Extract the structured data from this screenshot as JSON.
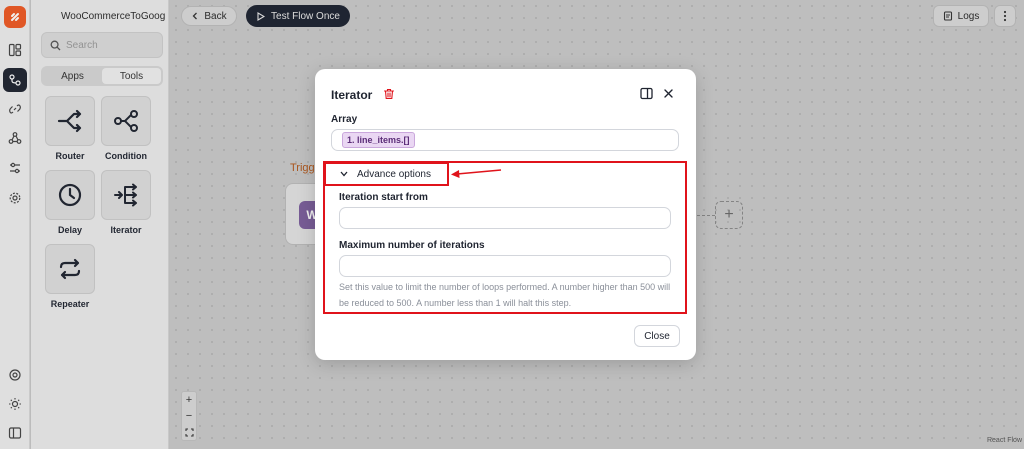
{
  "sidebar": {
    "flow_name": "WooCommerceToGoogle",
    "search_placeholder": "Search",
    "tabs": [
      {
        "label": "Apps",
        "active": false
      },
      {
        "label": "Tools",
        "active": true
      }
    ],
    "tools": [
      {
        "label": "Router",
        "icon": "router-icon"
      },
      {
        "label": "Condition",
        "icon": "condition-icon"
      },
      {
        "label": "Delay",
        "icon": "clock-icon"
      },
      {
        "label": "Iterator",
        "icon": "iterator-icon"
      },
      {
        "label": "Repeater",
        "icon": "repeat-icon"
      }
    ]
  },
  "toolbar": {
    "back_label": "Back",
    "test_label": "Test Flow Once",
    "logs_label": "Logs"
  },
  "canvas": {
    "trigger_label": "Trigg",
    "woo_letter": "W",
    "add_symbol": "+",
    "attribution": "React Flow",
    "zoom_in": "+",
    "zoom_out": "−"
  },
  "modal": {
    "title": "Iterator",
    "array_label": "Array",
    "array_chip": "1. line_items.[]",
    "advance_label": "Advance options",
    "iteration_start_label": "Iteration start from",
    "iteration_start_value": "",
    "max_iterations_label": "Maximum number of iterations",
    "max_iterations_value": "",
    "help_text": "Set this value to limit the number of loops performed. A number higher than 500 will be reduced to 500. A number less than 1 will halt this step.",
    "close_label": "Close"
  },
  "colors": {
    "accent": "#ee5a24",
    "dark": "#1d2331",
    "highlight": "#e0131b",
    "chip_bg": "#ead7f3"
  }
}
